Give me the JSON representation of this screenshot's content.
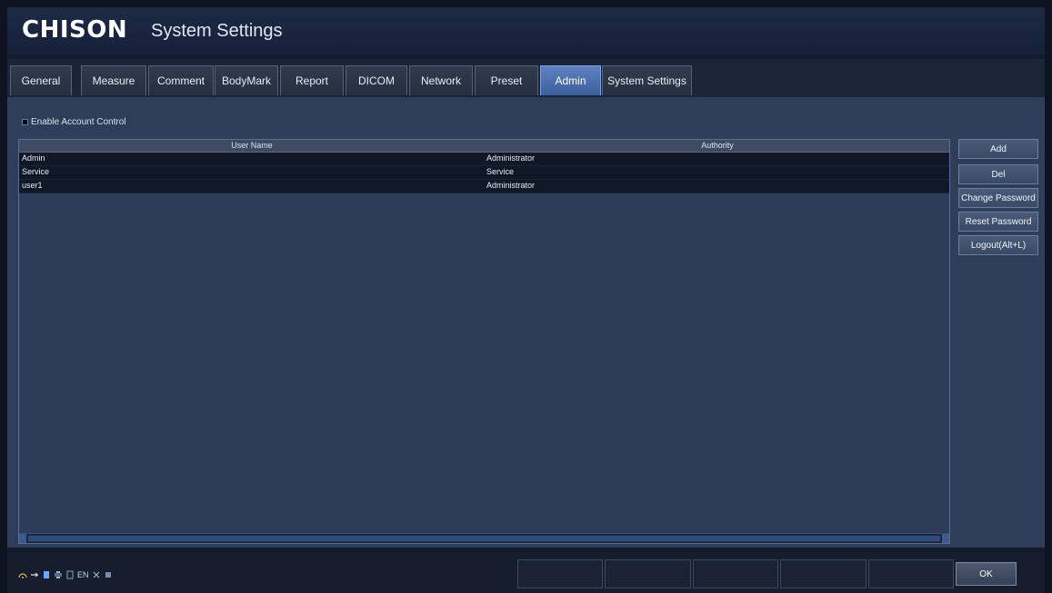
{
  "header": {
    "brand": "CHISON",
    "title": "System Settings"
  },
  "tabs": [
    {
      "label": "General",
      "active": false
    },
    {
      "label": "Measure",
      "active": false
    },
    {
      "label": "Comment",
      "active": false
    },
    {
      "label": "BodyMark",
      "active": false
    },
    {
      "label": "Report",
      "active": false
    },
    {
      "label": "DICOM",
      "active": false
    },
    {
      "label": "Network",
      "active": false
    },
    {
      "label": "Preset",
      "active": false
    },
    {
      "label": "Admin",
      "active": true
    },
    {
      "label": "System Settings",
      "active": false
    }
  ],
  "admin": {
    "enable_account_control_label": "Enable Account Control",
    "enable_account_control_checked": false,
    "table": {
      "headers": [
        "User Name",
        "Authority"
      ],
      "rows": [
        [
          "Admin",
          "Administrator"
        ],
        [
          "Service",
          "Service"
        ],
        [
          "user1",
          "Administrator"
        ]
      ]
    },
    "buttons": [
      "Add",
      "Del",
      "Change Password",
      "Reset Password",
      "Logout(Alt+L)"
    ]
  },
  "footer": {
    "status_text": "EN",
    "ok_label": "OK"
  },
  "colors": {
    "accent": "#5f82c0",
    "panel": "#2e3d5a",
    "row": "#101828"
  },
  "icons": [
    "network-icon",
    "usb-icon",
    "storage-icon",
    "printer-icon",
    "disk-icon",
    "language-icon",
    "input-icon",
    "device-icon"
  ]
}
